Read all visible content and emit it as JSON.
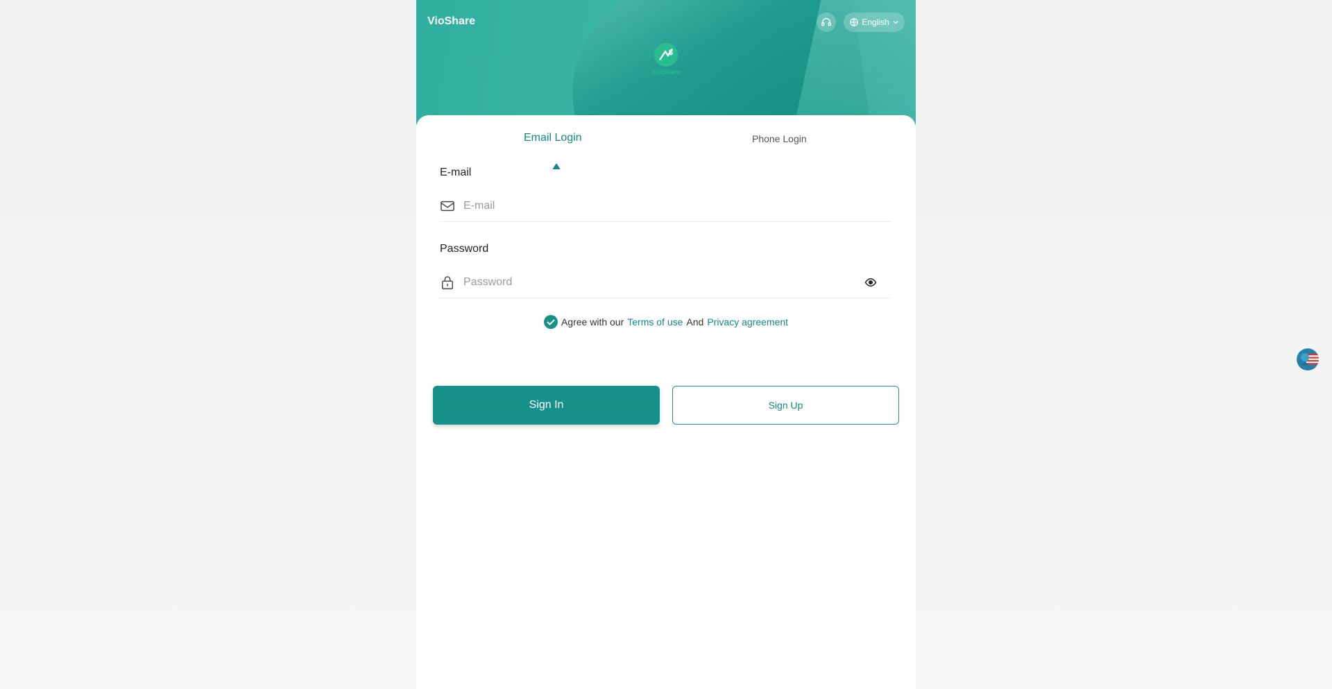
{
  "header": {
    "brand": "VioShare",
    "language": "English",
    "icons": {
      "support": "headset-icon",
      "language": "globe-icon",
      "dropdown": "chevron-down-icon"
    }
  },
  "tabs": [
    {
      "label": "Email Login",
      "active": true
    },
    {
      "label": "Phone Login",
      "active": false
    }
  ],
  "form": {
    "email": {
      "label": "E-mail",
      "placeholder": "E-mail",
      "value": "",
      "icon": "envelope-icon"
    },
    "password": {
      "label": "Password",
      "placeholder": "Password",
      "value": "",
      "icon": "lock-icon",
      "toggle_icon": "eye-icon"
    }
  },
  "agreement": {
    "checked": true,
    "prefix": "Agree with our",
    "terms_label": "Terms of use",
    "and_text": "And",
    "privacy_label": "Privacy agreement"
  },
  "actions": {
    "sign_in": "Sign In",
    "sign_up": "Sign Up"
  },
  "colors": {
    "accent": "#138a80",
    "button_primary": "#16918a",
    "header_gradient_start": "#2fae9f",
    "header_gradient_end": "#1f9b90",
    "logo_green": "#29c28f"
  },
  "floating": {
    "icon": "us-flag-support-icon"
  }
}
